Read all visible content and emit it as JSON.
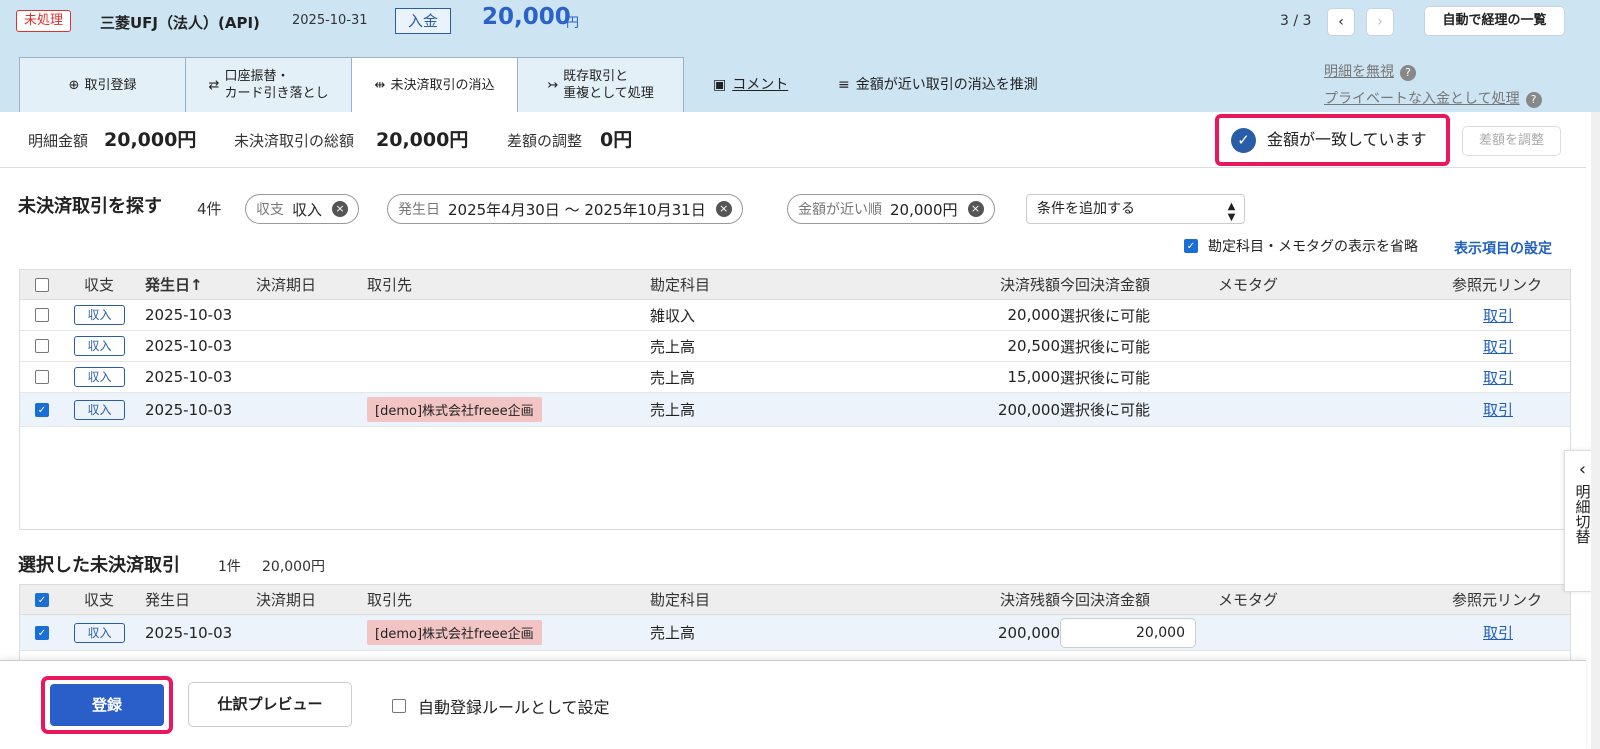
{
  "header": {
    "status_badge": "未処理",
    "bank_name": "三菱UFJ（法人）(API)",
    "date": "2025-10-31",
    "type": "入金",
    "amount": "20,000",
    "amount_unit": "円",
    "pager": "3 / 3",
    "prev_icon": "‹",
    "next_icon": "›",
    "auto_list_label": "自動で経理の一覧"
  },
  "tabs": [
    {
      "icon": "⊕",
      "label": "取引登録"
    },
    {
      "icon": "⇄",
      "label": "口座振替・\nカード引き落とし"
    },
    {
      "icon": "⇹",
      "label": "未決済取引の消込"
    },
    {
      "icon": "↣",
      "label": "既存取引と\n重複として処理"
    }
  ],
  "links": {
    "comment_icon": "▣",
    "comment": "コメント",
    "guess_icon": "≡",
    "guess": "金額が近い取引の消込を推測",
    "ignore": "明細を無視",
    "private": "プライベートな入金として処理",
    "help": "?"
  },
  "summary": {
    "detail_label": "明細金額",
    "detail_value": "20,000円",
    "total_label": "未決済取引の総額",
    "total_value": "20,000円",
    "diff_label": "差額の調整",
    "diff_value": "0円",
    "match_text": "金額が一致しています",
    "check_icon": "✓",
    "adjust_button": "差額を調整"
  },
  "search": {
    "title": "未決済取引を探す",
    "count": "4件",
    "chips": [
      {
        "label": "収支",
        "value": "収入"
      },
      {
        "label": "発生日",
        "value": "2025年4月30日 〜 2025年10月31日"
      },
      {
        "label": "金額が近い順",
        "value": "20,000円"
      }
    ],
    "chip_clear_icon": "×",
    "add_condition": "条件を追加する",
    "select_arrow": "▲▼",
    "omit_label": "勘定科目・メモタグの表示を省略",
    "settings_link": "表示項目の設定"
  },
  "table": {
    "headers": {
      "type": "収支",
      "date": "発生日",
      "sort_icon": "↑",
      "due": "決済期日",
      "partner": "取引先",
      "account": "勘定科目",
      "balance": "決済残額",
      "pay": "今回決済金額",
      "memo": "メモタグ",
      "ref": "参照元リンク"
    },
    "rows": [
      {
        "type": "収入",
        "date": "2025-10-03",
        "partner": "",
        "account": "雑収入",
        "balance": "20,000",
        "pay": "選択後に可能",
        "ref": "取引"
      },
      {
        "type": "収入",
        "date": "2025-10-03",
        "partner": "",
        "account": "売上高",
        "balance": "20,500",
        "pay": "選択後に可能",
        "ref": "取引"
      },
      {
        "type": "収入",
        "date": "2025-10-03",
        "partner": "",
        "account": "売上高",
        "balance": "15,000",
        "pay": "選択後に可能",
        "ref": "取引"
      },
      {
        "type": "収入",
        "date": "2025-10-03",
        "partner": "[demo]株式会社freee企画",
        "account": "売上高",
        "balance": "200,000",
        "pay": "選択後に可能",
        "ref": "取引"
      }
    ]
  },
  "selected": {
    "title": "選択した未決済取引",
    "count": "1件",
    "total": "20,000円",
    "row": {
      "type": "収入",
      "date": "2025-10-03",
      "partner": "[demo]株式会社freee企画",
      "account": "売上高",
      "balance": "200,000",
      "pay": "20,000",
      "ref": "取引"
    }
  },
  "footer": {
    "register": "登録",
    "preview": "仕訳プレビュー",
    "auto_rule": "自動登録ルールとして設定"
  },
  "side_tab": {
    "arrow": "‹",
    "label": "明細切替"
  },
  "checkmark": "✓"
}
